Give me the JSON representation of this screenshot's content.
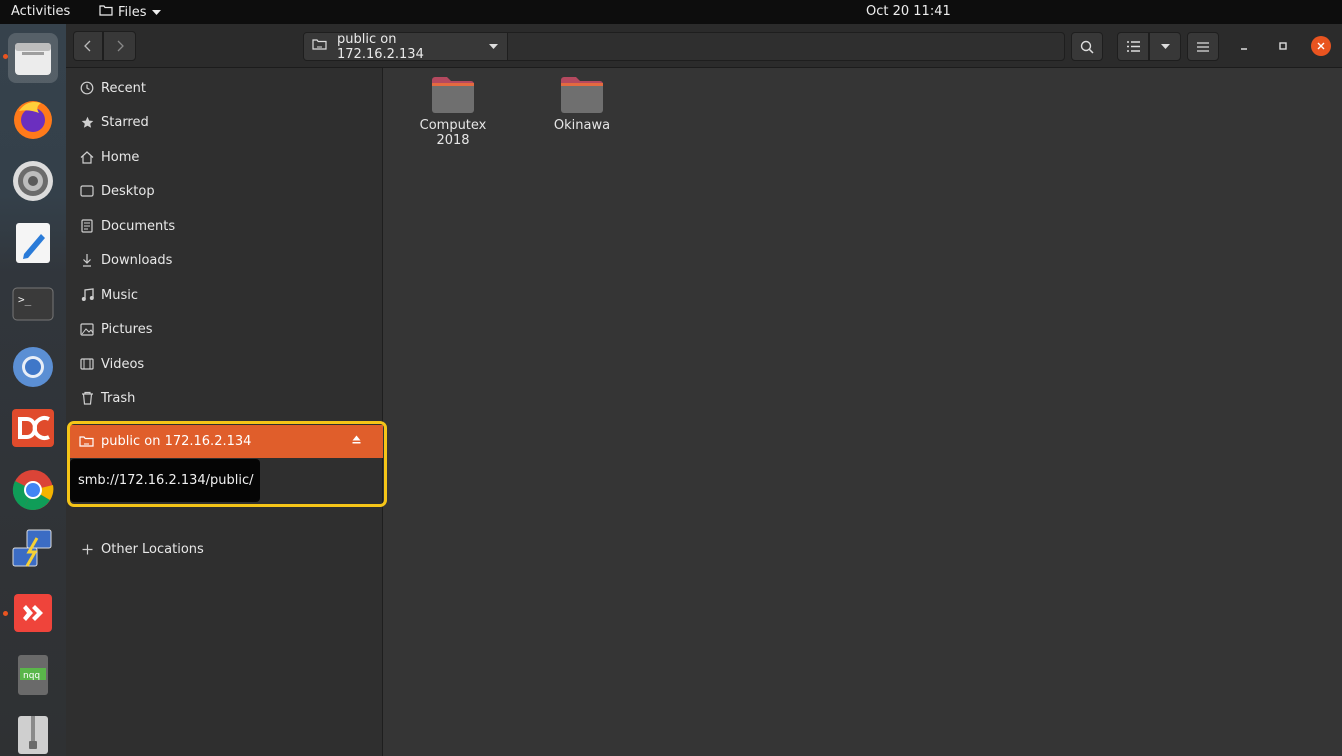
{
  "topbar": {
    "activities": "Activities",
    "app_menu": "Files",
    "clock": "Oct 20  11:41"
  },
  "dock": {
    "items": [
      {
        "icon": "files-icon",
        "running": true,
        "active": true
      },
      {
        "icon": "firefox-icon"
      },
      {
        "icon": "settings-icon"
      },
      {
        "icon": "text-editor-icon"
      },
      {
        "icon": "terminal-icon",
        "label": ">_"
      },
      {
        "icon": "chromium-icon"
      },
      {
        "icon": "doublecmd-icon"
      },
      {
        "icon": "chrome-icon"
      },
      {
        "icon": "network-connect-icon"
      },
      {
        "icon": "anydesk-icon",
        "running": true
      },
      {
        "icon": "notepadqq-icon",
        "label": "nqq"
      },
      {
        "icon": "archive-manager-icon"
      }
    ]
  },
  "headerbar": {
    "location": "public on 172.16.2.134"
  },
  "sidebar": {
    "items": [
      {
        "label": "Recent",
        "icon": "clock-icon"
      },
      {
        "label": "Starred",
        "icon": "star-icon"
      },
      {
        "label": "Home",
        "icon": "home-icon"
      },
      {
        "label": "Desktop",
        "icon": "desktop-icon"
      },
      {
        "label": "Documents",
        "icon": "document-icon"
      },
      {
        "label": "Downloads",
        "icon": "download-icon"
      },
      {
        "label": "Music",
        "icon": "music-icon"
      },
      {
        "label": "Pictures",
        "icon": "picture-icon"
      },
      {
        "label": "Videos",
        "icon": "video-icon"
      },
      {
        "label": "Trash",
        "icon": "trash-icon"
      }
    ],
    "mounted": {
      "label": "public on 172.16.2.134",
      "icon": "network-folder-icon"
    },
    "other_locations": "Other Locations"
  },
  "tooltip": "smb://172.16.2.134/public/",
  "folders": [
    {
      "line1": "Computex",
      "line2": "2018"
    },
    {
      "line1": "Okinawa",
      "line2": ""
    }
  ],
  "colors": {
    "accent": "#e05e2b",
    "highlight_box": "#f5c518",
    "close_button": "#e95420"
  }
}
